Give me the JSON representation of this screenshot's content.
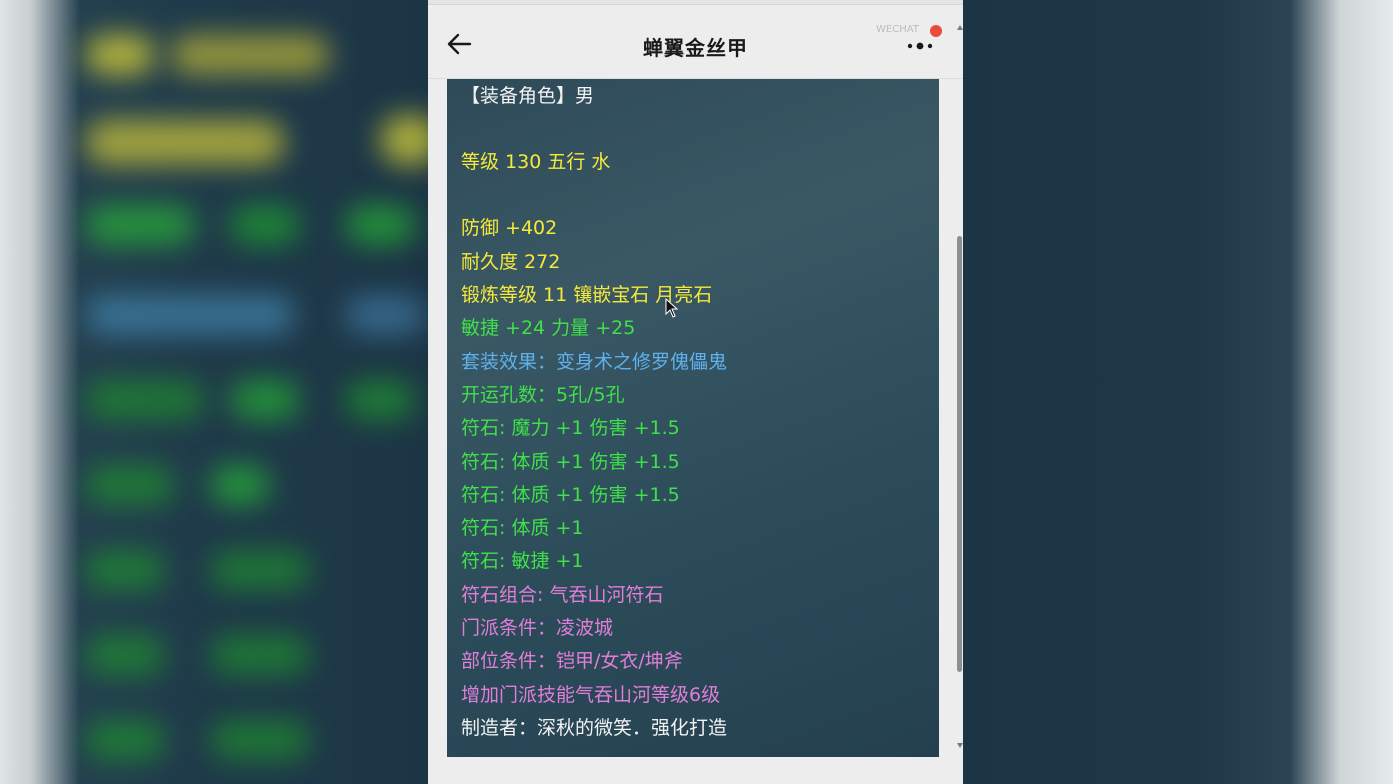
{
  "window": {
    "title": "蝉翼金丝甲"
  },
  "navbar": {
    "back_icon": "arrow-left-icon",
    "more_icon": "more-dots-icon",
    "badge_text": "WECHAT"
  },
  "item": {
    "lines": [
      {
        "text": "【装备角色】男",
        "color": "white"
      },
      {
        "text": "等级 130 五行 水",
        "color": "yellow"
      },
      {
        "text": "防御 +402",
        "color": "yellow"
      },
      {
        "text": "耐久度 272",
        "color": "yellow"
      },
      {
        "text": "锻炼等级 11 镶嵌宝石 月亮石",
        "color": "yellow"
      },
      {
        "text": "敏捷 +24 力量 +25",
        "color": "green"
      },
      {
        "text": "套装效果：变身术之修罗傀儡鬼",
        "color": "blue"
      },
      {
        "text": "开运孔数：5孔/5孔",
        "color": "green"
      },
      {
        "text": "符石: 魔力 +1 伤害 +1.5",
        "color": "green"
      },
      {
        "text": "符石: 体质 +1 伤害 +1.5",
        "color": "green"
      },
      {
        "text": "符石: 体质 +1 伤害 +1.5",
        "color": "green"
      },
      {
        "text": "符石: 体质 +1",
        "color": "green"
      },
      {
        "text": "符石: 敏捷 +1",
        "color": "green"
      },
      {
        "text": "符石组合: 气吞山河符石",
        "color": "pink"
      },
      {
        "text": "门派条件：凌波城",
        "color": "pink"
      },
      {
        "text": "部位条件：铠甲/女衣/坤斧",
        "color": "pink"
      },
      {
        "text": "增加门派技能气吞山河等级6级",
        "color": "pink"
      },
      {
        "text": "制造者：深秋的微笑．强化打造",
        "color": "white"
      }
    ]
  },
  "colors": {
    "white": "#f2f2f2",
    "yellow": "#f5e93a",
    "green": "#3fe04a",
    "blue": "#5eb1ec",
    "pink": "#e07ed8"
  }
}
